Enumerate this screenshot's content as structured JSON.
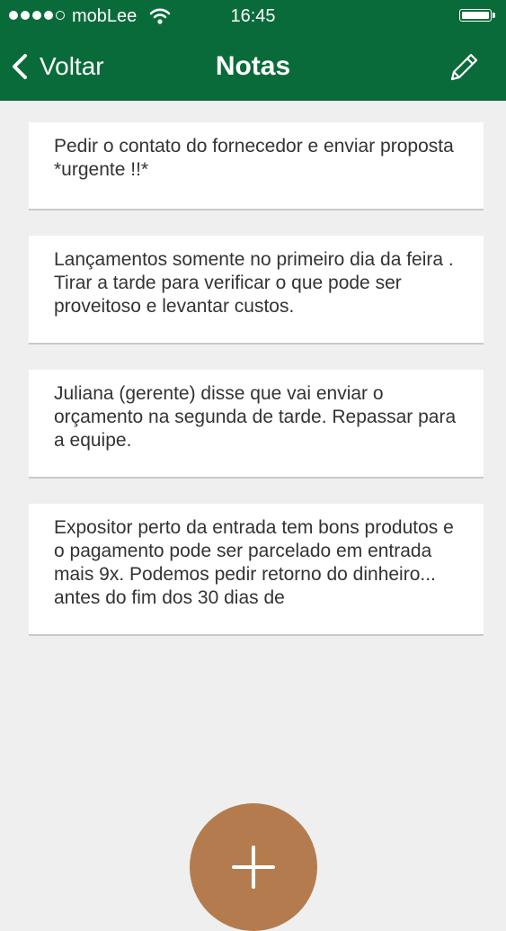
{
  "status_bar": {
    "carrier": "mobLee",
    "time": "16:45",
    "signal_icon": "signal-dots-icon",
    "wifi_icon": "wifi-icon",
    "battery_icon": "battery-icon"
  },
  "nav": {
    "back_label": "Voltar",
    "title": "Notas",
    "back_icon": "chevron-left-icon",
    "edit_icon": "pencil-icon"
  },
  "notes": [
    {
      "text": "Pedir o contato do fornecedor e enviar proposta *urgente !!*"
    },
    {
      "text": "Lançamentos somente no primeiro dia da feira . Tirar a tarde para verificar o que pode ser proveitoso e levantar custos."
    },
    {
      "text": "Juliana (gerente) disse que vai enviar o orçamento na segunda de tarde. Repassar para a equipe."
    },
    {
      "text": "Expositor perto da entrada tem bons produtos e o pagamento pode ser parcelado em entrada mais 9x. Podemos pedir retorno do dinheiro... antes do fim dos 30 dias de"
    }
  ],
  "fab": {
    "icon": "plus-icon"
  },
  "colors": {
    "header": "#0a6b3a",
    "background": "#efefef",
    "fab": "#b47c4e"
  }
}
